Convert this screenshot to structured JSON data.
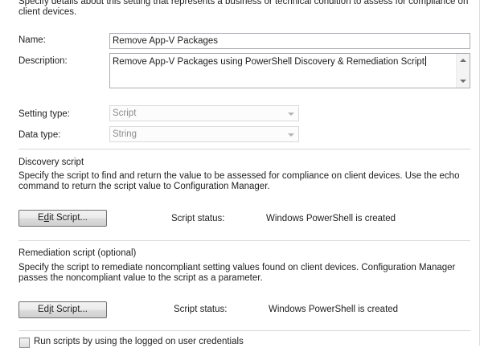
{
  "intro": "Specify details about this setting that represents a business or technical condition to assess for compliance on client devices.",
  "name": {
    "label": "Name:",
    "value": "Remove App-V Packages"
  },
  "description": {
    "label": "Description:",
    "value": "Remove App-V Packages using PowerShell Discovery & Remediation Script"
  },
  "setting_type": {
    "label": "Setting type:",
    "value": "Script"
  },
  "data_type": {
    "label": "Data type:",
    "value": "String"
  },
  "discovery": {
    "title": "Discovery script",
    "description": "Specify the script to find and return the value to be assessed for compliance on client devices. Use the echo command to return the script value to Configuration Manager.",
    "button_pre": "E",
    "button_acc": "d",
    "button_post": "it Script...",
    "status_label": "Script status:",
    "status_value": "Windows PowerShell is created"
  },
  "remediation": {
    "title": "Remediation script (optional)",
    "description": "Specify the script to remediate noncompliant setting values found on client devices. Configuration Manager passes the noncompliant value to the script as a parameter.",
    "button_pre": "Ed",
    "button_acc": "i",
    "button_post": "t Script...",
    "status_label": "Script status:",
    "status_value": "Windows PowerShell is created"
  },
  "run_as_user": {
    "label": "Run scripts by using the logged on user credentials",
    "checked": false
  }
}
